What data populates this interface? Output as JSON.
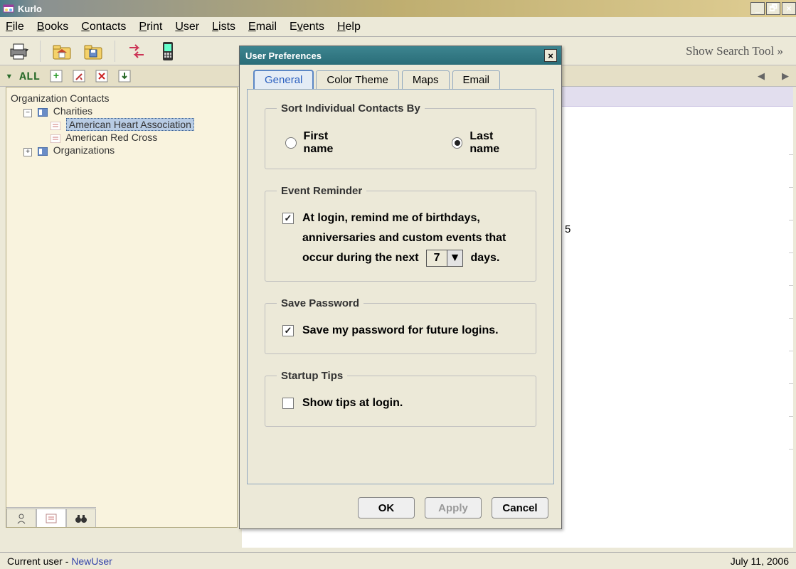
{
  "app": {
    "title": "Kurlo"
  },
  "menu": [
    "File",
    "Books",
    "Contacts",
    "Print",
    "User",
    "Lists",
    "Email",
    "Events",
    "Help"
  ],
  "showSearch": "Show Search Tool »",
  "allbar": {
    "label": "▾ ALL"
  },
  "tree": {
    "root": "Organization Contacts",
    "charities": "Charities",
    "item1": "American Heart Association",
    "item2": "American Red Cross",
    "orgs": "Organizations"
  },
  "rightPeek": "5",
  "status": {
    "userLabel": "Current user - ",
    "userName": "NewUser",
    "date": "July 11, 2006"
  },
  "dialog": {
    "title": "User Preferences",
    "tabs": {
      "general": "General",
      "color": "Color Theme",
      "maps": "Maps",
      "email": "Email"
    },
    "sort": {
      "legend": "Sort Individual Contacts By",
      "first": "First name",
      "last": "Last name",
      "selected": "last"
    },
    "reminder": {
      "legend": "Event Reminder",
      "textA": "At login, remind me of birthdays,",
      "textB": "anniversaries and custom events that",
      "textC_prefix": "occur during the next",
      "textC_suffix": "days.",
      "days": "7",
      "checked": true
    },
    "savepw": {
      "legend": "Save Password",
      "text": "Save my password for future logins.",
      "checked": true
    },
    "tips": {
      "legend": "Startup Tips",
      "text": "Show tips at login.",
      "checked": false
    },
    "buttons": {
      "ok": "OK",
      "apply": "Apply",
      "cancel": "Cancel"
    }
  }
}
